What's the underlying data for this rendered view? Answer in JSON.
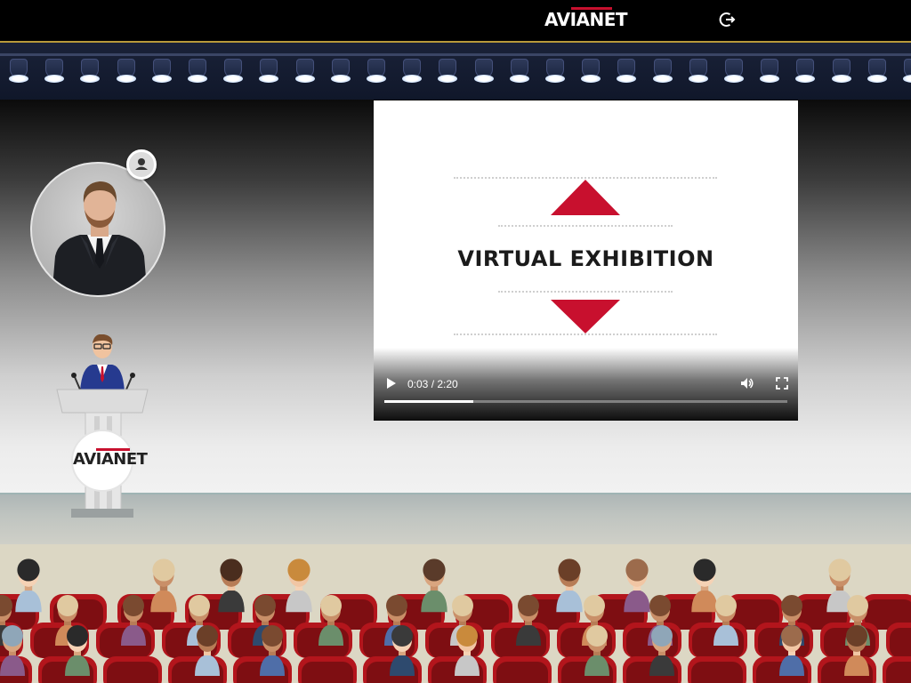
{
  "brand": {
    "logo_text": "AVIANET",
    "accent": "#c8102e"
  },
  "header": {
    "power_icon": "power-icon"
  },
  "speaker": {
    "avatar_icon": "speaker-portrait",
    "user_button_icon": "user-icon"
  },
  "podium": {
    "logo_text": "AVIANET"
  },
  "video": {
    "slide_title": "VIRTUAL EXHIBITION",
    "current_time": "0:03",
    "duration": "2:20",
    "time_display": "0:03 / 2:20",
    "progress": 0.22,
    "controls": [
      "play-icon",
      "volume-icon",
      "fullscreen-icon"
    ]
  },
  "colors": {
    "stage_top": "#0b0b0b",
    "stage_bottom": "#f2f2f2",
    "gold_line": "#b89a3a",
    "seat": "#b3151c"
  }
}
